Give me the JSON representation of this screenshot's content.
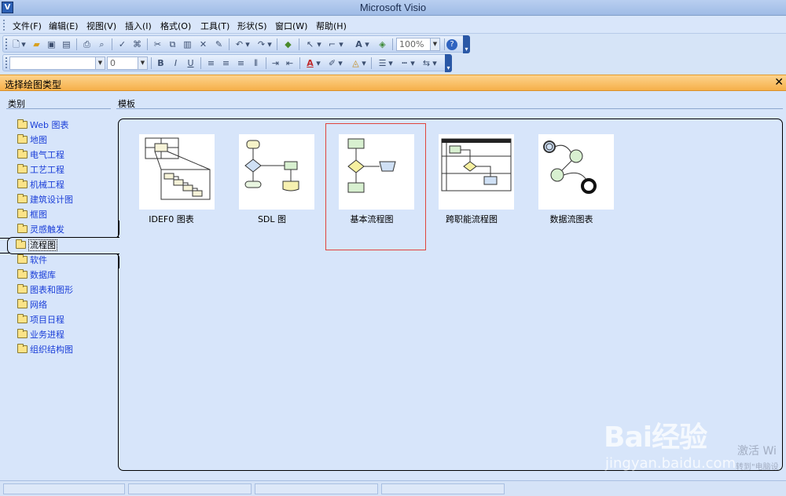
{
  "window": {
    "title": "Microsoft Visio"
  },
  "menu": [
    {
      "label": "文件(F)"
    },
    {
      "label": "编辑(E)"
    },
    {
      "label": "视图(V)"
    },
    {
      "label": "插入(I)"
    },
    {
      "label": "格式(O)"
    },
    {
      "label": "工具(T)"
    },
    {
      "label": "形状(S)"
    },
    {
      "label": "窗口(W)"
    },
    {
      "label": "帮助(H)"
    }
  ],
  "toolbar": {
    "zoom": "100%",
    "font_size": "0",
    "bold": "B",
    "italic": "I",
    "underline": "U",
    "font_color_label": "A",
    "text_tool_label": "A"
  },
  "dialog": {
    "title": "选择绘图类型",
    "category_header": "类别",
    "template_header": "模板",
    "categories": [
      {
        "label": "Web 图表"
      },
      {
        "label": "地图"
      },
      {
        "label": "电气工程"
      },
      {
        "label": "工艺工程"
      },
      {
        "label": "机械工程"
      },
      {
        "label": "建筑设计图"
      },
      {
        "label": "框图"
      },
      {
        "label": "灵感触发"
      },
      {
        "label": "流程图"
      },
      {
        "label": "软件"
      },
      {
        "label": "数据库"
      },
      {
        "label": "图表和图形"
      },
      {
        "label": "网络"
      },
      {
        "label": "项目日程"
      },
      {
        "label": "业务进程"
      },
      {
        "label": "组织结构图"
      }
    ],
    "selected_category": "流程图",
    "templates": [
      {
        "label": "IDEF0 图表"
      },
      {
        "label": "SDL 图"
      },
      {
        "label": "基本流程图"
      },
      {
        "label": "跨职能流程图"
      },
      {
        "label": "数据流图表"
      }
    ],
    "selected_template": "基本流程图"
  },
  "watermark": {
    "brand": "Bai经验",
    "url": "jingyan.baidu.com",
    "activate": "激活 Wi",
    "activate_sub": "转到\"电脑设"
  },
  "colors": {
    "dialog_header": "#f6b04a",
    "selection_frame": "#e0443c",
    "category_link": "#1a3ed8"
  }
}
